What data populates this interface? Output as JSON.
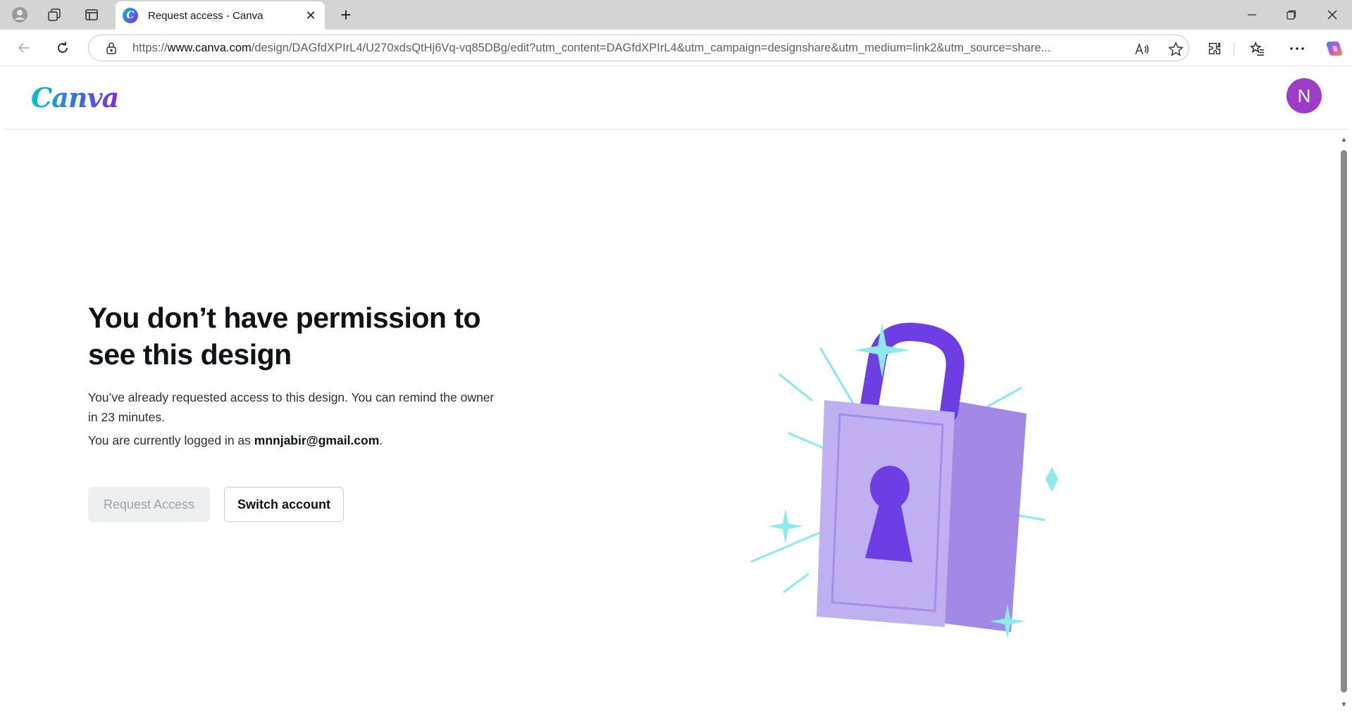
{
  "browser": {
    "tab_title": "Request access - Canva",
    "tab_close": "✕",
    "new_tab": "+",
    "url_prefix": "https://",
    "url_host": "www.canva.com",
    "url_rest": "/design/DAGfdXPIrL4/U270xdsQtHj6Vq-vq85DBg/edit?utm_content=DAGfdXPIrL4&utm_campaign=designshare&utm_medium=link2&utm_source=share..."
  },
  "header": {
    "logo": "Canva",
    "avatar_initial": "N"
  },
  "main": {
    "heading": "You don’t have permission to see this design",
    "reminder_text": "You’ve already requested access to this design. You can remind the owner in 23 minutes.",
    "logged_in_prefix": "You are currently logged in as ",
    "logged_in_email": "mnnjabir@gmail.com",
    "logged_in_suffix": ".",
    "request_button": "Request Access",
    "switch_button": "Switch account"
  },
  "colors": {
    "lock_body": "#c0b0f2",
    "lock_side": "#a08ae6",
    "shackle": "#6d3ee3",
    "keyhole": "#6d3ee3",
    "sparkle": "#8eeaea"
  }
}
